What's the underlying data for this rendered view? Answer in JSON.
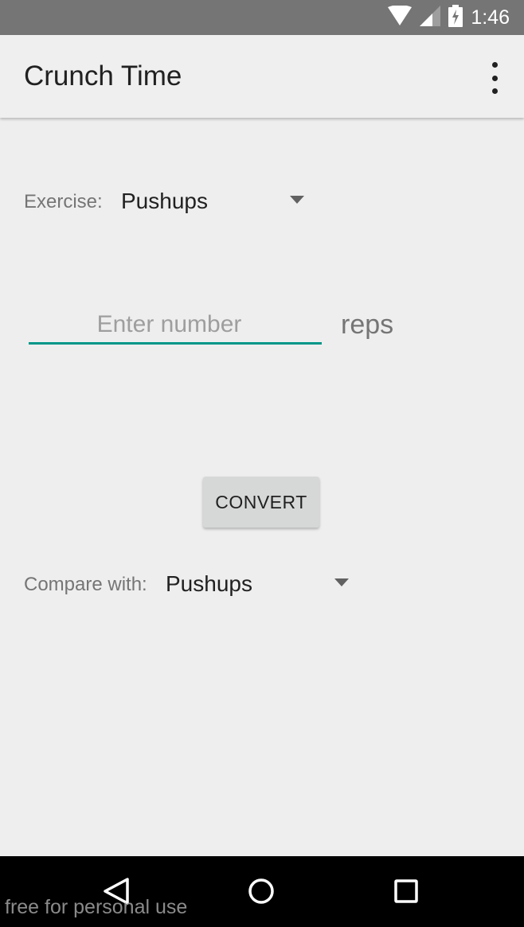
{
  "status_bar": {
    "time": "1:46"
  },
  "app_bar": {
    "title": "Crunch Time"
  },
  "exercise": {
    "label": "Exercise:",
    "selected": "Pushups"
  },
  "reps_input": {
    "placeholder": "Enter number",
    "value": "",
    "unit": "reps"
  },
  "convert_button": {
    "label": "CONVERT"
  },
  "compare": {
    "label": "Compare with:",
    "selected": "Pushups"
  },
  "watermark": {
    "text": "free for personal use"
  },
  "colors": {
    "accent": "#009688",
    "status_bar": "#757575",
    "app_bar": "#efefef",
    "background": "#eeeeee",
    "nav_bar": "#000000"
  },
  "icons": [
    "wifi-icon",
    "cell-signal-icon",
    "battery-charging-icon",
    "overflow-menu-icon",
    "back-icon",
    "home-icon",
    "recents-icon",
    "dropdown-arrow-icon"
  ]
}
